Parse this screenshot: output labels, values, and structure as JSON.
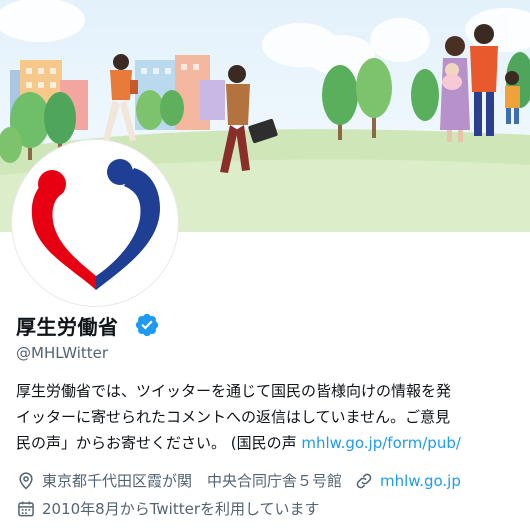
{
  "profile": {
    "name": "厚生労働省",
    "handle": "@MHLWitter",
    "verified": true,
    "bio_lines": [
      "厚生労働省では、ツイッターを通じて国民の皆様向けの情報を発",
      "イッターに寄せられたコメントへの返信はしていません。ご意見",
      "民の声」からお寄せください。 (国民の声 "
    ],
    "bio_link": "mhlw.go.jp/form/pub/",
    "location": "東京都千代田区霞が関　中央合同庁舎５号館",
    "website": "mhlw.go.jp",
    "joined": "2010年8月からTwitterを利用しています"
  },
  "icons": {
    "verified": "verified-badge-icon",
    "location": "location-pin-icon",
    "link": "link-icon",
    "calendar": "calendar-icon"
  },
  "colors": {
    "accent": "#1d9bf0",
    "logo_red": "#e60012",
    "logo_blue": "#1f3f95",
    "secondary_text": "#536471"
  }
}
